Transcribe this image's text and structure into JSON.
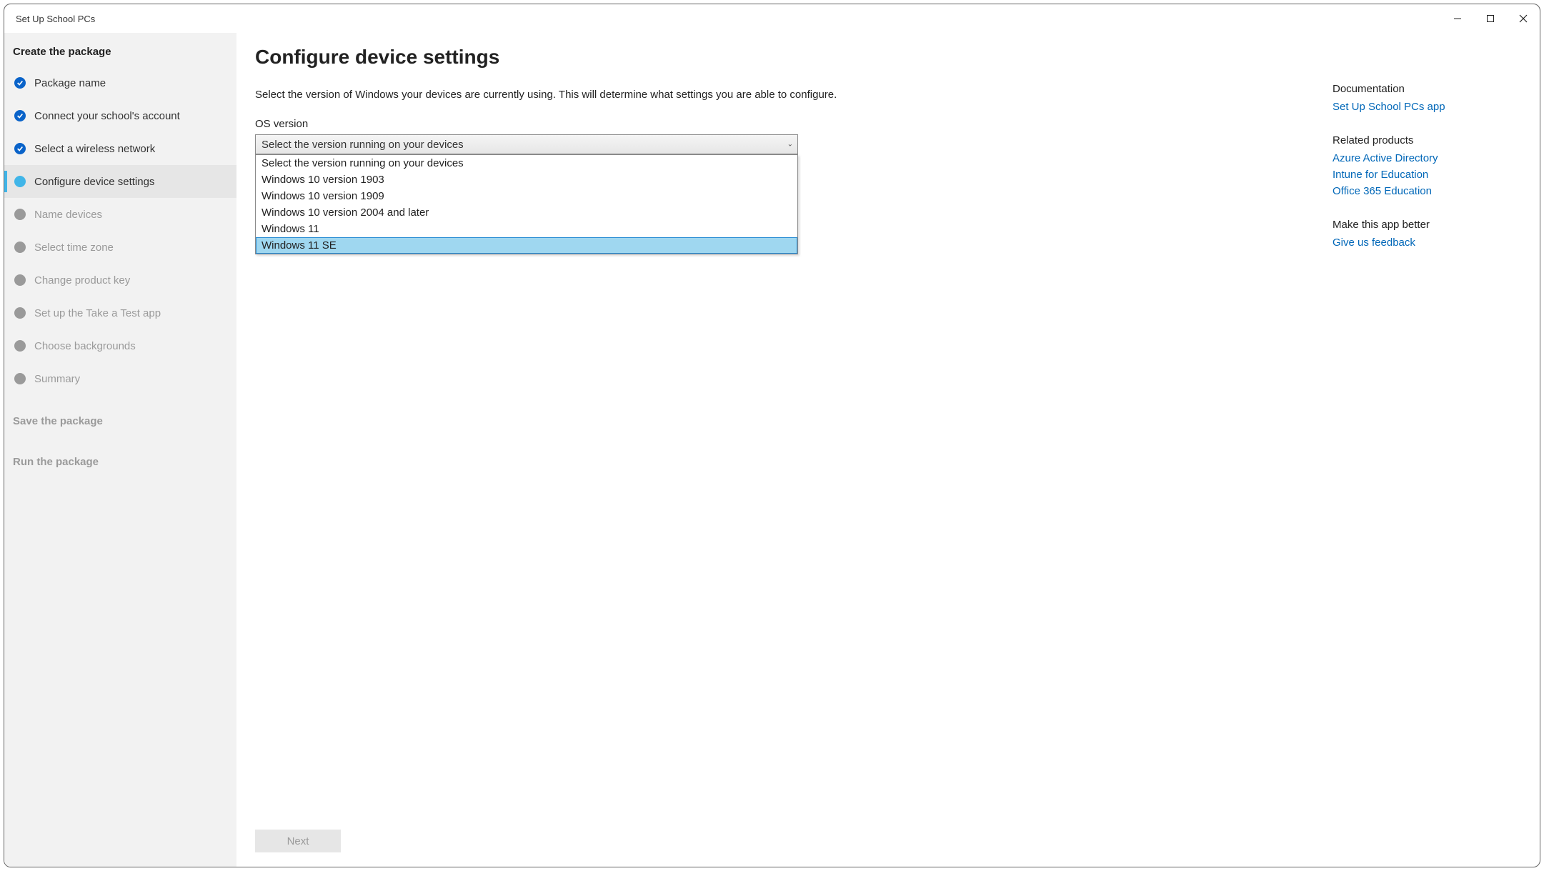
{
  "window": {
    "title": "Set Up School PCs"
  },
  "sidebar": {
    "sections": {
      "create": "Create the package",
      "save": "Save the package",
      "run": "Run the package"
    },
    "items": [
      {
        "label": "Package name",
        "state": "done"
      },
      {
        "label": "Connect your school's account",
        "state": "done"
      },
      {
        "label": "Select a wireless network",
        "state": "done"
      },
      {
        "label": "Configure device settings",
        "state": "active"
      },
      {
        "label": "Name devices",
        "state": "disabled"
      },
      {
        "label": "Select time zone",
        "state": "disabled"
      },
      {
        "label": "Change product key",
        "state": "disabled"
      },
      {
        "label": "Set up the Take a Test app",
        "state": "disabled"
      },
      {
        "label": "Choose backgrounds",
        "state": "disabled"
      },
      {
        "label": "Summary",
        "state": "disabled"
      }
    ]
  },
  "main": {
    "title": "Configure device settings",
    "description": "Select the version of Windows your devices are currently using. This will determine what settings you are able to configure.",
    "field_label": "OS version",
    "combo_value": "Select the version running on your devices",
    "options": [
      "Select the version running on your devices",
      "Windows 10 version 1903",
      "Windows 10 version 1909",
      "Windows 10 version 2004 and later",
      "Windows 11",
      "Windows 11 SE"
    ],
    "highlight_index": 5,
    "next_button": "Next"
  },
  "rail": {
    "doc_heading": "Documentation",
    "doc_links": [
      "Set Up School PCs app"
    ],
    "related_heading": "Related products",
    "related_links": [
      "Azure Active Directory",
      "Intune for Education",
      "Office 365 Education"
    ],
    "feedback_heading": "Make this app better",
    "feedback_links": [
      "Give us feedback"
    ]
  }
}
